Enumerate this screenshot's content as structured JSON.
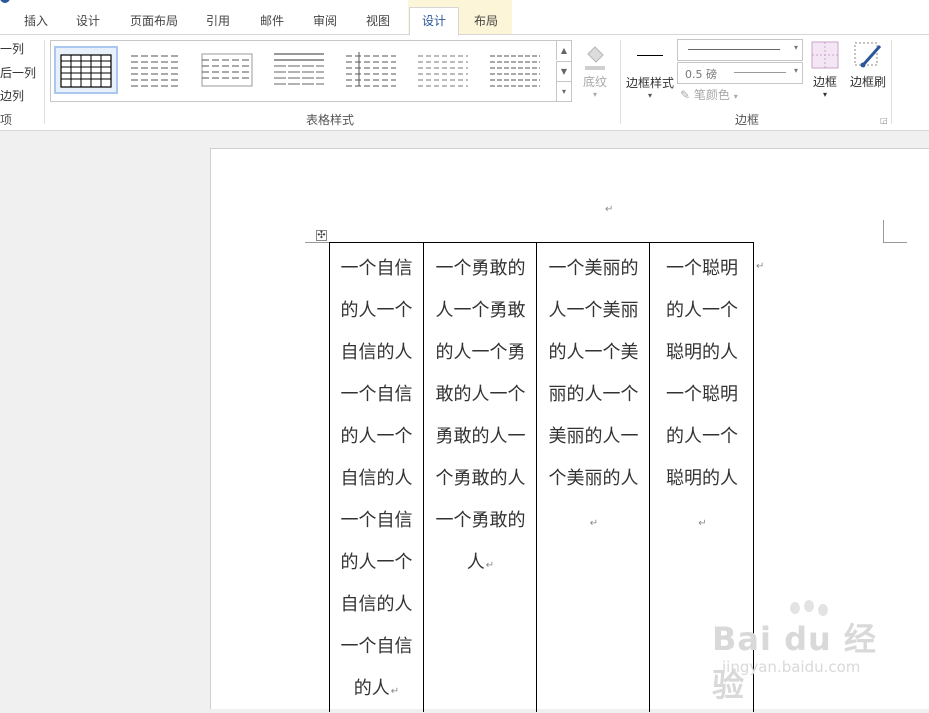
{
  "tabs": [
    {
      "label": "插入",
      "active": false
    },
    {
      "label": "设计",
      "active": false
    },
    {
      "label": "页面布局",
      "active": false
    },
    {
      "label": "引用",
      "active": false
    },
    {
      "label": "邮件",
      "active": false
    },
    {
      "label": "审阅",
      "active": false
    },
    {
      "label": "视图",
      "active": false
    },
    {
      "label": "设计",
      "active": true
    },
    {
      "label": "布局",
      "active": false
    }
  ],
  "style_options": {
    "items": [
      "一列",
      "后一列",
      "边列"
    ],
    "group_label": "项"
  },
  "table_styles": {
    "group_label": "表格样式",
    "shading_label": "底纹"
  },
  "borders": {
    "border_styles_label": "边框样式",
    "pen_weight": "0.5 磅",
    "pen_color_label": "笔颜色",
    "borders_label": "边框",
    "border_painter_label": "边框刷",
    "group_label": "边框"
  },
  "table": {
    "columns": [
      "一个自信的人一个自信的人一个自信的人一个自信的人一个自信的人一个自信的人一个自信的人",
      "一个勇敢的人一个勇敢的人一个勇敢的人一个勇敢的人一个勇敢的人一个勇敢的人",
      "一个美丽的人一个美丽的人一个美丽的人一个美丽的人一个美丽的人",
      "一个聪明的人一个聪明的人一个聪明的人一个聪明的人"
    ]
  },
  "watermark": {
    "brand": "Bai du 经验",
    "url": "jingyan.baidu.com"
  },
  "colors": {
    "accent": "#2b579a",
    "context_tab": "#fdf5d7"
  }
}
